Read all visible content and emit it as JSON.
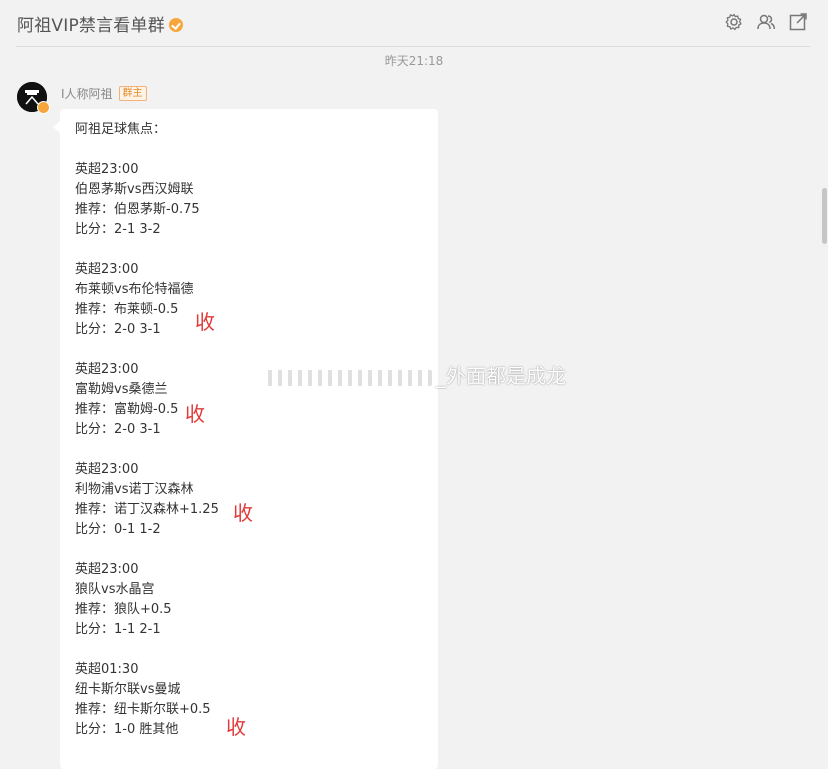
{
  "header": {
    "title": "阿祖VIP禁言看单群",
    "icons": [
      "gear-icon",
      "group-members-icon",
      "popout-icon"
    ]
  },
  "timestamp": "昨天21:18",
  "sender": {
    "name": "I人称阿祖",
    "role": "群主"
  },
  "message": {
    "heading": "阿祖足球焦点：",
    "matches": [
      {
        "time": "英超23:00",
        "teams": "伯恩茅斯vs西汉姆联",
        "tip": "推荐：伯恩茅斯-0.75",
        "score": "比分：2-1 3-2",
        "stamp": ""
      },
      {
        "time": "英超23:00",
        "teams": "布莱顿vs布伦特福德",
        "tip": "推荐：布莱顿-0.5",
        "score": "比分：2-0 3-1",
        "stamp": "收"
      },
      {
        "time": "英超23:00",
        "teams": "富勒姆vs桑德兰",
        "tip": "推荐：富勒姆-0.5",
        "score": "比分：2-0 3-1",
        "stamp": "收"
      },
      {
        "time": "英超23:00",
        "teams": "利物浦vs诺丁汉森林",
        "tip": "推荐：诺丁汉森林+1.25",
        "score": "比分：0-1 1-2",
        "stamp": "收"
      },
      {
        "time": "英超23:00",
        "teams": "狼队vs水晶宫",
        "tip": "推荐：狼队+0.5",
        "score": "比分：1-1 2-1",
        "stamp": ""
      },
      {
        "time": "英超01:30",
        "teams": "纽卡斯尔联vs曼城",
        "tip": "推荐：纽卡斯尔联+0.5",
        "score": "比分：1-0 胜其他",
        "stamp": "收"
      }
    ]
  },
  "watermark": "_外面都是成龙",
  "colors": {
    "background": "#f2f2f2",
    "bubble": "#ffffff",
    "stamp_red": "#e23a3a",
    "badge_orange": "#f7a63b"
  }
}
